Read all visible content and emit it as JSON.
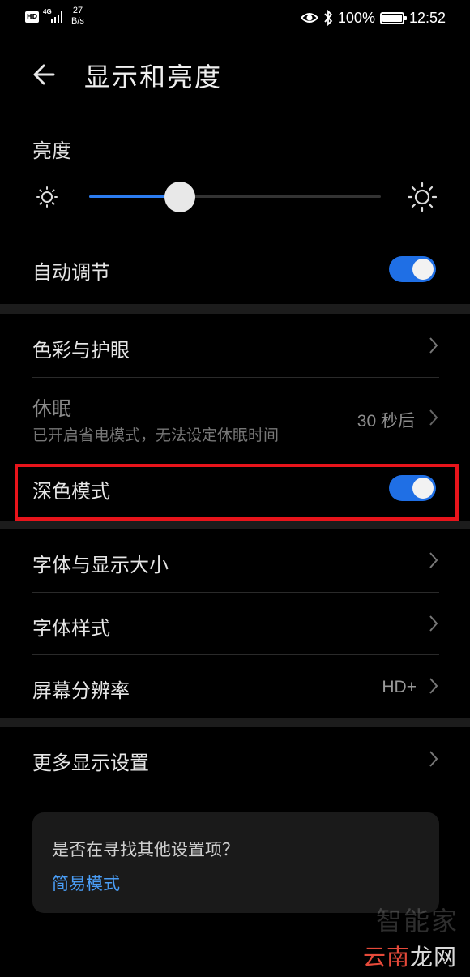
{
  "status_bar": {
    "hd": "HD",
    "network": "4G",
    "speed_value": "27",
    "speed_unit": "B/s",
    "battery": "100%",
    "time": "12:52"
  },
  "header": {
    "back_icon": "arrow-left-icon",
    "title": "显示和亮度"
  },
  "brightness": {
    "label": "亮度",
    "level": 0.31,
    "accent": "#2b7cf0"
  },
  "rows": {
    "auto_adjust": {
      "label": "自动调节",
      "toggle_on": true
    },
    "color_eye": {
      "label": "色彩与护眼"
    },
    "sleep": {
      "label": "休眠",
      "subtitle": "已开启省电模式，无法设定休眠时间",
      "value": "30 秒后"
    },
    "dark_mode": {
      "label": "深色模式",
      "toggle_on": true
    },
    "font_size": {
      "label": "字体与显示大小"
    },
    "font_style": {
      "label": "字体样式"
    },
    "resolution": {
      "label": "屏幕分辨率",
      "value": "HD+"
    },
    "more": {
      "label": "更多显示设置"
    }
  },
  "card": {
    "question": "是否在寻找其他设置项？",
    "link": "简易模式"
  },
  "watermark": {
    "top": "智能家",
    "bottom_red": "云南",
    "bottom_white": "龙网"
  },
  "colors": {
    "toggle_on": "#1f6fe5",
    "highlight": "#e8141b",
    "link": "#4a9df5"
  }
}
